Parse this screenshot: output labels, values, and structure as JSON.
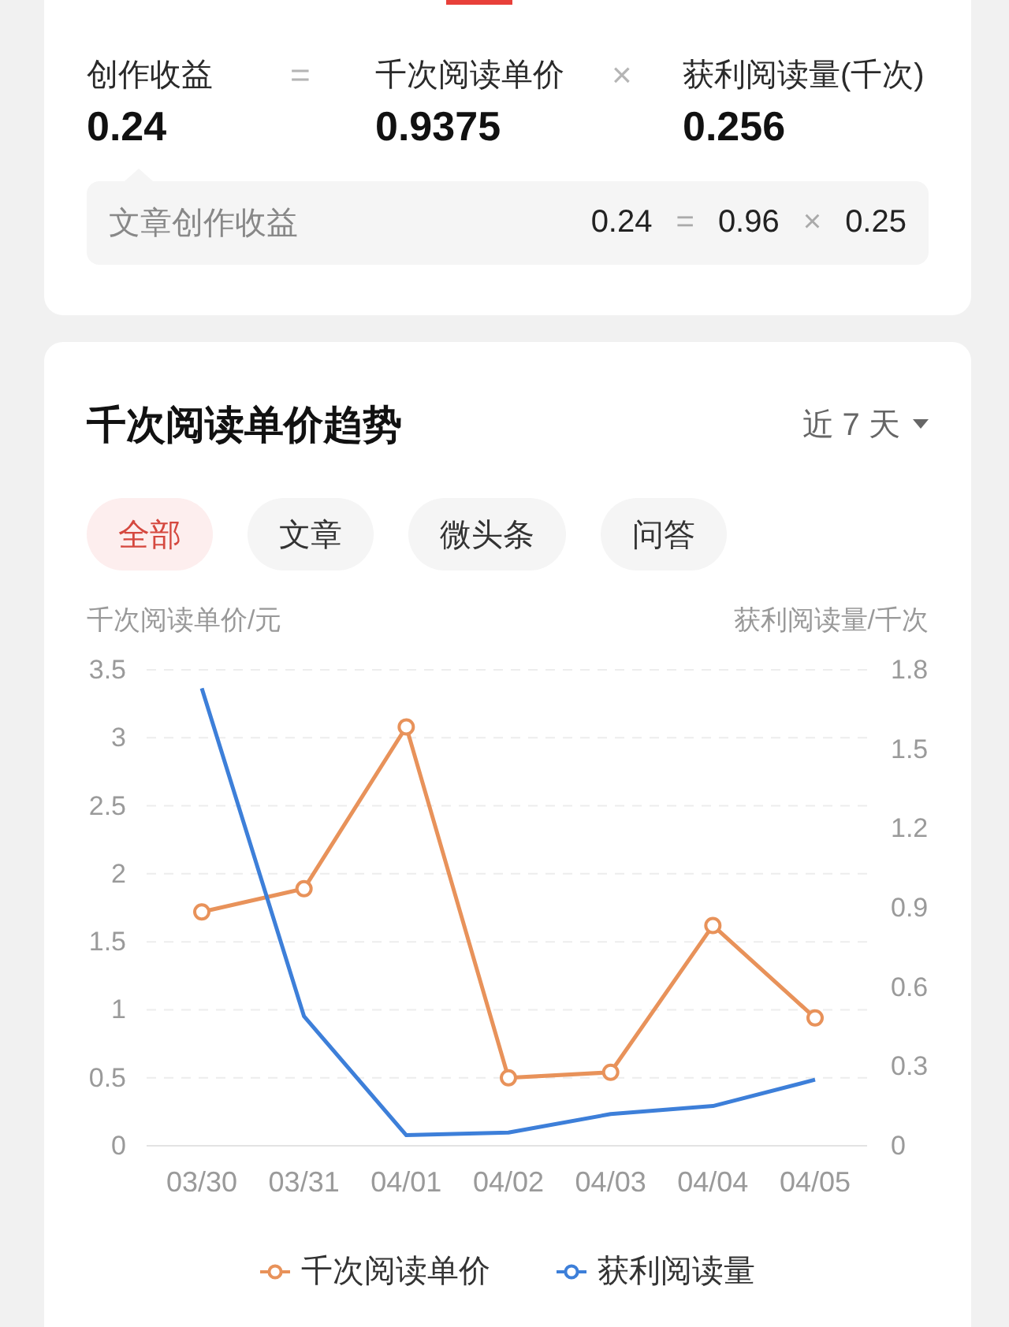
{
  "summary": {
    "formula": [
      {
        "kind": "term",
        "label": "创作收益",
        "value": "0.24"
      },
      {
        "kind": "operator",
        "text": "="
      },
      {
        "kind": "term",
        "label": "千次阅读单价",
        "value": "0.9375"
      },
      {
        "kind": "operator",
        "text": "×"
      },
      {
        "kind": "term",
        "label": "获利阅读量(千次)",
        "value": "0.256"
      }
    ],
    "breakdown": {
      "label": "文章创作收益",
      "parts": [
        {
          "kind": "number",
          "text": "0.24"
        },
        {
          "kind": "operator",
          "text": "="
        },
        {
          "kind": "number",
          "text": "0.96"
        },
        {
          "kind": "operator",
          "text": "×"
        },
        {
          "kind": "number",
          "text": "0.25"
        }
      ]
    }
  },
  "trend": {
    "title": "千次阅读单价趋势",
    "range": "近 7 天",
    "filters": [
      {
        "label": "全部",
        "selected": true
      },
      {
        "label": "文章",
        "selected": false
      },
      {
        "label": "微头条",
        "selected": false
      },
      {
        "label": "问答",
        "selected": false
      }
    ],
    "chart_data": {
      "type": "line",
      "ylabel": "千次阅读单价/元",
      "y2label": "获利阅读量/千次",
      "categories": [
        "03/30",
        "03/31",
        "04/01",
        "04/02",
        "04/03",
        "04/04",
        "04/05"
      ],
      "series": [
        {
          "name": "千次阅读单价",
          "color": "#e8925a",
          "marker": "circle",
          "values": [
            1.72,
            1.89,
            3.08,
            0.5,
            0.54,
            1.62,
            0.94
          ]
        },
        {
          "name": "获利阅读量",
          "color": "#3d7fd9",
          "axis": "y2",
          "values": [
            1.73,
            0.49,
            0.04,
            0.05,
            0.12,
            0.15,
            0.25
          ]
        }
      ],
      "ylim": [
        0,
        3.5
      ],
      "yticks": [
        0,
        0.5,
        1,
        1.5,
        2,
        2.5,
        3,
        3.5
      ],
      "y2lim": [
        0,
        1.8
      ],
      "y2ticks": [
        0,
        0.3,
        0.6,
        0.9,
        1.2,
        1.5,
        1.8
      ],
      "grid": true
    }
  }
}
